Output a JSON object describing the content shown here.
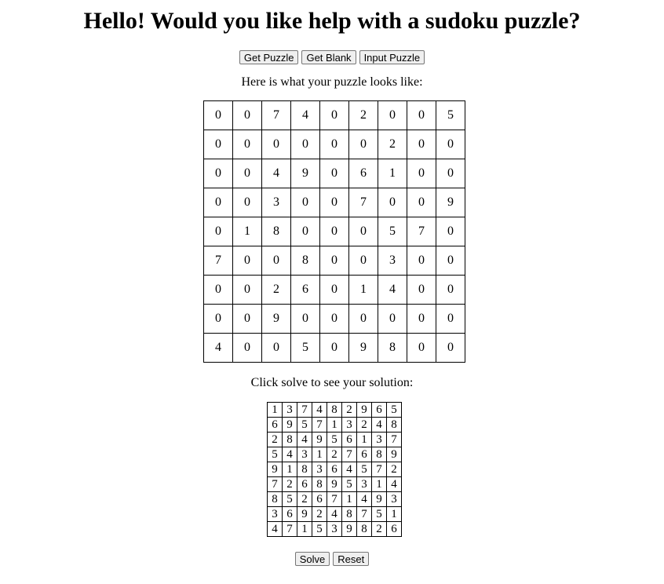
{
  "header": {
    "title": "Hello! Would you like help with a sudoku puzzle?"
  },
  "toolbar": {
    "get_puzzle_label": "Get Puzzle",
    "get_blank_label": "Get Blank",
    "input_puzzle_label": "Input Puzzle"
  },
  "puzzle": {
    "caption": "Here is what your puzzle looks like:",
    "rows": [
      [
        0,
        0,
        7,
        4,
        0,
        2,
        0,
        0,
        5
      ],
      [
        0,
        0,
        0,
        0,
        0,
        0,
        2,
        0,
        0
      ],
      [
        0,
        0,
        4,
        9,
        0,
        6,
        1,
        0,
        0
      ],
      [
        0,
        0,
        3,
        0,
        0,
        7,
        0,
        0,
        9
      ],
      [
        0,
        1,
        8,
        0,
        0,
        0,
        5,
        7,
        0
      ],
      [
        7,
        0,
        0,
        8,
        0,
        0,
        3,
        0,
        0
      ],
      [
        0,
        0,
        2,
        6,
        0,
        1,
        4,
        0,
        0
      ],
      [
        0,
        0,
        9,
        0,
        0,
        0,
        0,
        0,
        0
      ],
      [
        4,
        0,
        0,
        5,
        0,
        9,
        8,
        0,
        0
      ]
    ]
  },
  "solution": {
    "caption": "Click solve to see your solution:",
    "rows": [
      [
        1,
        3,
        7,
        4,
        8,
        2,
        9,
        6,
        5
      ],
      [
        6,
        9,
        5,
        7,
        1,
        3,
        2,
        4,
        8
      ],
      [
        2,
        8,
        4,
        9,
        5,
        6,
        1,
        3,
        7
      ],
      [
        5,
        4,
        3,
        1,
        2,
        7,
        6,
        8,
        9
      ],
      [
        9,
        1,
        8,
        3,
        6,
        4,
        5,
        7,
        2
      ],
      [
        7,
        2,
        6,
        8,
        9,
        5,
        3,
        1,
        4
      ],
      [
        8,
        5,
        2,
        6,
        7,
        1,
        4,
        9,
        3
      ],
      [
        3,
        6,
        9,
        2,
        4,
        8,
        7,
        5,
        1
      ],
      [
        4,
        7,
        1,
        5,
        3,
        9,
        8,
        2,
        6
      ]
    ]
  },
  "actions": {
    "solve_label": "Solve",
    "reset_label": "Reset"
  }
}
